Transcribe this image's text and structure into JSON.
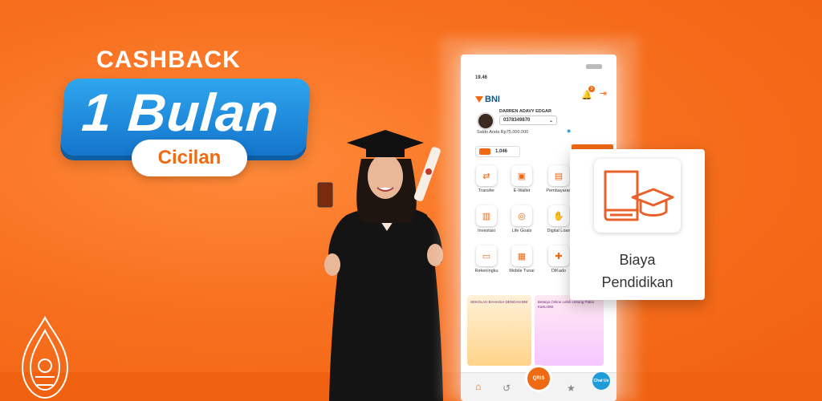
{
  "headline": {
    "cashback": "CASHBACK",
    "duration": "1 Bulan",
    "type": "Cicilan"
  },
  "phone": {
    "status_time": "19.46",
    "logo": "BNI",
    "notification_count": "3",
    "user_name": "DARREN ADAVY EDGAR",
    "account_number": "0378349870",
    "balance_label": "Saldo Anda",
    "balance_value": "Rp75.000.000",
    "promo_value": "1.046",
    "menu": [
      {
        "label": "Transfer",
        "icon": "transfer-icon",
        "glyph": "⇄"
      },
      {
        "label": "E-Wallet",
        "icon": "wallet-icon",
        "glyph": "▣"
      },
      {
        "label": "Pembayaran",
        "icon": "bill-icon",
        "glyph": "▤"
      },
      {
        "label": "Investasi",
        "icon": "chart-icon",
        "glyph": "▥"
      },
      {
        "label": "Life Goals",
        "icon": "target-icon",
        "glyph": "◎"
      },
      {
        "label": "Digital Loan",
        "icon": "loan-icon",
        "glyph": "✋"
      },
      {
        "label": "Rekeningku",
        "icon": "card-icon",
        "glyph": "▭"
      },
      {
        "label": "Mobile Tunai",
        "icon": "cash-icon",
        "glyph": "▦"
      },
      {
        "label": "DiKado",
        "icon": "gift-icon",
        "glyph": "✚"
      }
    ],
    "banner1_text": "SEKOLAH BAHAGIA DENGAN BNI",
    "banner2_text": "Belanja Online Lebih Untung Pakai Kartu BNI",
    "qris_label": "QRIS",
    "chat_label": "Chat Us"
  },
  "popup": {
    "label_line1": "Biaya",
    "label_line2": "Pendidikan"
  },
  "colors": {
    "accent": "#f06a14",
    "badge_blue": "#1a8fe0"
  }
}
